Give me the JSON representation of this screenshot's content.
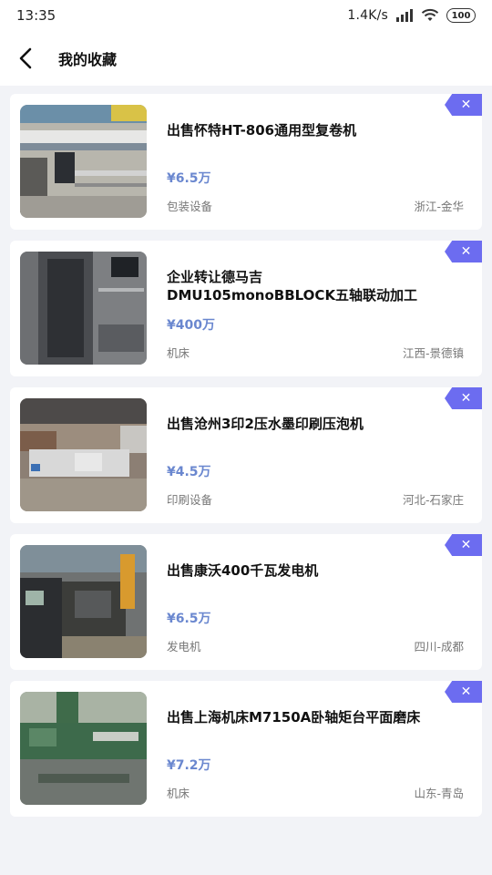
{
  "status_bar": {
    "time": "13:35",
    "net_speed": "1.4K/s",
    "battery": "100"
  },
  "header": {
    "title": "我的收藏"
  },
  "items": [
    {
      "title": "出售怀特HT-806通用型复卷机",
      "price": "¥6.5万",
      "category": "包装设备",
      "location": "浙江-金华",
      "remove_label": "✕"
    },
    {
      "title": "企业转让德马吉DMU105monoBBLOCK五轴联动加工",
      "price": "¥400万",
      "category": "机床",
      "location": "江西-景德镇",
      "remove_label": "✕"
    },
    {
      "title": "出售沧州3印2压水墨印刷压泡机",
      "price": "¥4.5万",
      "category": "印刷设备",
      "location": "河北-石家庄",
      "remove_label": "✕"
    },
    {
      "title": "出售康沃400千瓦发电机",
      "price": "¥6.5万",
      "category": "发电机",
      "location": "四川-成都",
      "remove_label": "✕"
    },
    {
      "title": "出售上海机床M7150A卧轴矩台平面磨床",
      "price": "¥7.2万",
      "category": "机床",
      "location": "山东-青岛",
      "remove_label": "✕"
    }
  ]
}
